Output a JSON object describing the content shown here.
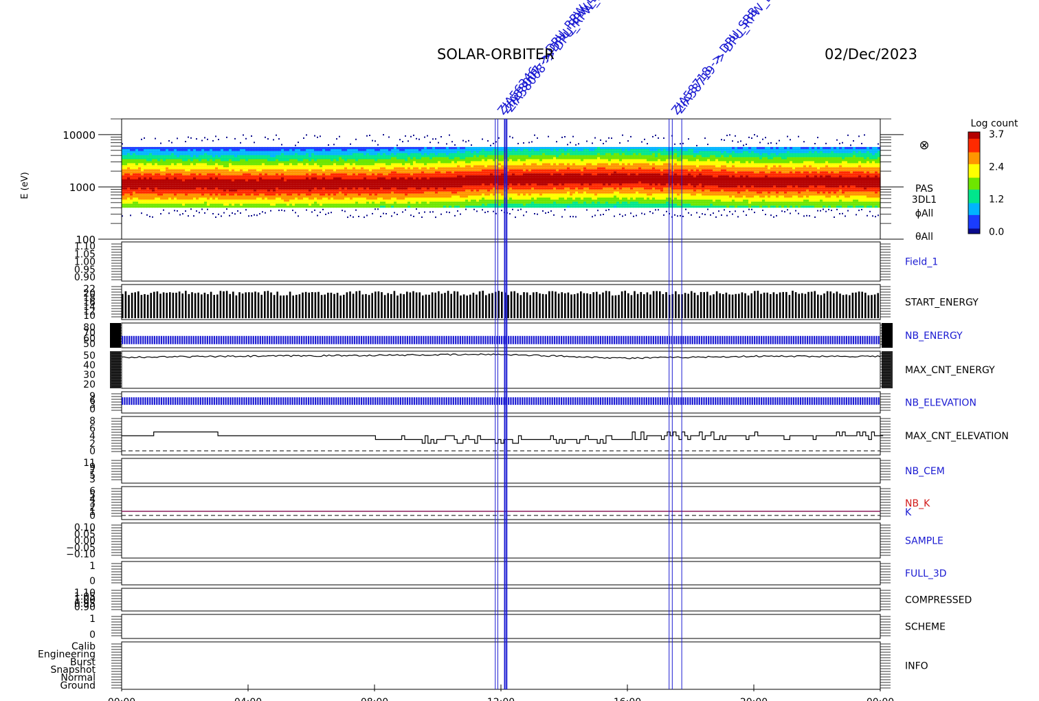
{
  "header": {
    "mission": "SOLAR-ORBITER",
    "date": "02/Dec/2023"
  },
  "events": {
    "color": "#1a1ad2",
    "groups": [
      {
        "time_h": 11.9,
        "labels": [
          "ZIA56346 -> DPU_RPW_BM",
          "ZIA58007 -> DPU_RPW_BM",
          "ZIA58008 -> DPU_RPW_BM"
        ]
      },
      {
        "time_h": 17.4,
        "labels": [
          "ZIA58718 -> DPU_SRB",
          "ZIA58719 -> DPU_RPW_BM"
        ]
      }
    ],
    "vertical_lines_h": [
      11.82,
      11.9,
      12.12,
      12.18,
      17.32,
      17.42,
      17.72
    ]
  },
  "x_axis": {
    "ticks": [
      "00:00",
      "04:00",
      "08:00",
      "12:00",
      "16:00",
      "20:00",
      "00:00"
    ],
    "tick_hours": [
      0,
      4,
      8,
      12,
      16,
      20,
      24
    ]
  },
  "spectrogram": {
    "ylabel": "E (eV)",
    "yticks": [
      {
        "label": "10000",
        "value": 10000
      },
      {
        "label": "1000",
        "value": 1000
      },
      {
        "label": "100",
        "value": 100
      }
    ],
    "ylim": [
      100,
      20000
    ],
    "side_labels": [
      "PAS",
      "3DL1",
      "ϕAll",
      "θAll"
    ],
    "side_symbol": "⊗",
    "colorbar": {
      "title": "Log count",
      "ticks": [
        "3.7",
        "2.4",
        "1.2",
        "0.0"
      ],
      "range": [
        0.0,
        3.7
      ],
      "colors": [
        "#0a0a8c",
        "#1a3cff",
        "#00b4ff",
        "#00e68c",
        "#6ee600",
        "#ffff00",
        "#ff9600",
        "#ff2a00",
        "#b40000"
      ]
    }
  },
  "panels": [
    {
      "name": "Field_1",
      "yticks": [
        "1.10",
        "1.05",
        "1.00",
        "0.95",
        "0.90"
      ],
      "label_color": "#1a1ad2"
    },
    {
      "name": "START_ENERGY",
      "yticks": [
        "22",
        "20",
        "18",
        "16",
        "14",
        "12",
        "10"
      ],
      "label_color": "#000000"
    },
    {
      "name": "NB_ENERGY",
      "yticks": [
        "80",
        "70",
        "60",
        "50"
      ],
      "label_color": "#1a1ad2"
    },
    {
      "name": "MAX_CNT_ENERGY",
      "yticks": [
        "50",
        "40",
        "30",
        "20"
      ],
      "label_color": "#000000"
    },
    {
      "name": "NB_ELEVATION",
      "yticks": [
        "9",
        "6",
        "3",
        "0"
      ],
      "label_color": "#1a1ad2"
    },
    {
      "name": "MAX_CNT_ELEVATION",
      "yticks": [
        "8",
        "6",
        "4",
        "2",
        "0"
      ],
      "label_color": "#000000"
    },
    {
      "name": "NB_CEM",
      "yticks": [
        "11",
        "9",
        "7",
        "5",
        "3"
      ],
      "label_color": "#1a1ad2"
    },
    {
      "name": "NB_K",
      "second_name": "K",
      "yticks": [
        "6",
        "5",
        "4",
        "3",
        "2",
        "1",
        "0"
      ],
      "label_color": "#d21a1a",
      "second_color": "#1a1ad2"
    },
    {
      "name": "SAMPLE",
      "yticks": [
        "0.10",
        "0.05",
        "0.00",
        "−0.05",
        "−0.10"
      ],
      "label_color": "#1a1ad2"
    },
    {
      "name": "FULL_3D",
      "yticks": [
        "1",
        "0"
      ],
      "label_color": "#1a1ad2"
    },
    {
      "name": "COMPRESSED",
      "yticks": [
        "1.10",
        "1.05",
        "1.00",
        "0.95",
        "0.90"
      ],
      "label_color": "#000000"
    },
    {
      "name": "SCHEME",
      "yticks": [
        "1",
        "0"
      ],
      "label_color": "#000000"
    },
    {
      "name": "INFO",
      "yticks": [
        "Calib",
        "Engineering",
        "Burst",
        "Snapshot",
        "Normal",
        "Ground"
      ],
      "label_color": "#000000"
    }
  ],
  "chart_data": {
    "type": "heatmap",
    "title": "SOLAR-ORBITER",
    "ylabel": "E (eV)",
    "x_range_hours": [
      0,
      24
    ],
    "x_ticks": [
      "00:00",
      "04:00",
      "08:00",
      "12:00",
      "16:00",
      "20:00",
      "00:00"
    ],
    "y_range": [
      100,
      20000
    ],
    "log_scale_y": true,
    "z_label": "Log count",
    "z_range": [
      0.0,
      3.7
    ],
    "peak_energy_band": [
      {
        "time_h": 0,
        "energy_ev": 1150
      },
      {
        "time_h": 4,
        "energy_ev": 1100
      },
      {
        "time_h": 8,
        "energy_ev": 1150
      },
      {
        "time_h": 10,
        "energy_ev": 1200
      },
      {
        "time_h": 12,
        "energy_ev": 1400
      },
      {
        "time_h": 16,
        "energy_ev": 1450
      },
      {
        "time_h": 20,
        "energy_ev": 1250
      },
      {
        "time_h": 24,
        "energy_ev": 1250
      }
    ],
    "start_energy_level": 20,
    "nb_energy_level": 64,
    "nb_elevation_level": 8,
    "max_cnt_energy": [
      {
        "time_h": 0,
        "value": 48
      },
      {
        "time_h": 4,
        "value": 49
      },
      {
        "time_h": 8,
        "value": 50
      },
      {
        "time_h": 12,
        "value": 51
      },
      {
        "time_h": 16,
        "value": 47
      },
      {
        "time_h": 20,
        "value": 49
      },
      {
        "time_h": 24,
        "value": 49
      }
    ],
    "max_cnt_elevation": [
      {
        "time_h": 0,
        "value": 4
      },
      {
        "time_h": 1,
        "value": 5
      },
      {
        "time_h": 3,
        "value": 4
      },
      {
        "time_h": 8,
        "value": 3
      },
      {
        "time_h": 12,
        "value": 3
      },
      {
        "time_h": 16,
        "value": 4
      },
      {
        "time_h": 24,
        "value": 4
      }
    ],
    "k_level": 1
  }
}
